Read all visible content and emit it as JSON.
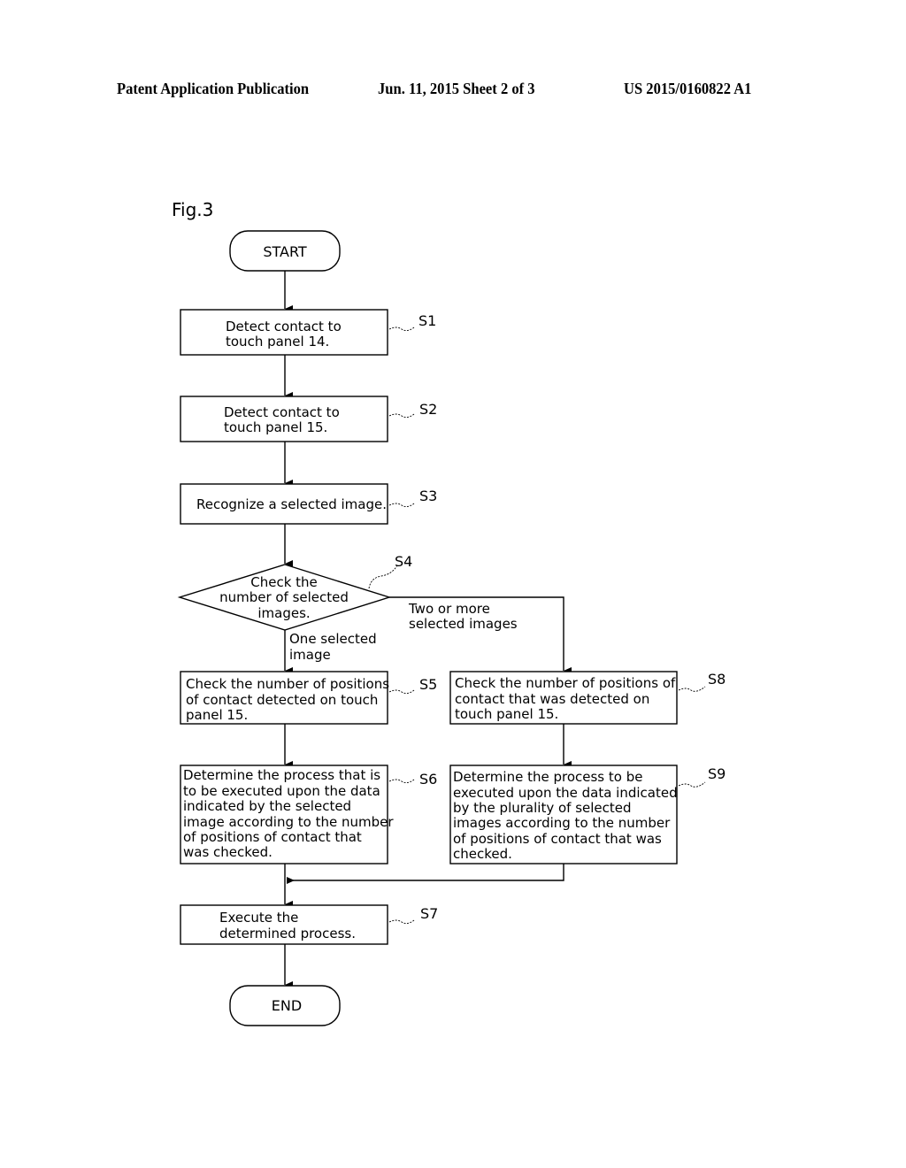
{
  "header": {
    "publication": "Patent Application Publication",
    "date_sheet": "Jun. 11, 2015  Sheet 2 of 3",
    "number": "US 2015/0160822 A1"
  },
  "figure": {
    "label": "Fig.3",
    "start": "START",
    "end": "END",
    "steps": {
      "s1": {
        "id": "S1",
        "lines": [
          "Detect contact to",
          "touch panel 14."
        ]
      },
      "s2": {
        "id": "S2",
        "lines": [
          "Detect contact to",
          "touch panel 15."
        ]
      },
      "s3": {
        "id": "S3",
        "lines": [
          "Recognize a selected image."
        ]
      },
      "s4": {
        "id": "S4",
        "lines": [
          "Check the",
          "number of selected",
          "images."
        ]
      },
      "s5": {
        "id": "S5",
        "lines": [
          "Check the number of positions",
          "of contact detected on touch",
          "panel 15."
        ]
      },
      "s6": {
        "id": "S6",
        "lines": [
          "Determine the process that is",
          "to be executed upon the data",
          "indicated by the selected",
          "image according to the number",
          "of positions of contact that",
          "was checked."
        ]
      },
      "s7": {
        "id": "S7",
        "lines": [
          "Execute the",
          "determined process."
        ]
      },
      "s8": {
        "id": "S8",
        "lines": [
          "Check the number of positions of",
          "contact that was detected on",
          "touch panel 15."
        ]
      },
      "s9": {
        "id": "S9",
        "lines": [
          "Determine the process to be",
          "executed upon the data indicated",
          "by the plurality of selected",
          "images according to the number",
          "of positions of contact that was",
          "checked."
        ]
      }
    },
    "branches": {
      "one": [
        "One selected",
        "image"
      ],
      "two_or_more": [
        "Two or more",
        "selected images"
      ]
    }
  }
}
